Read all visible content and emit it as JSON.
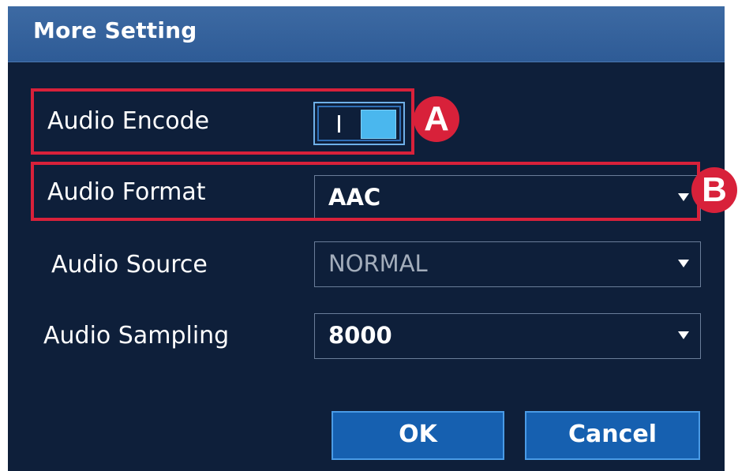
{
  "dialog": {
    "title": "More Setting"
  },
  "fields": {
    "audio_encode": {
      "label": "Audio Encode",
      "toggle_mark": "I",
      "enabled": true
    },
    "audio_format": {
      "label": "Audio Format",
      "value": "AAC"
    },
    "audio_source": {
      "label": "Audio Source",
      "value": "NORMAL",
      "disabled": true
    },
    "audio_sampling": {
      "label": "Audio Sampling",
      "value": "8000"
    }
  },
  "buttons": {
    "ok": "OK",
    "cancel": "Cancel"
  },
  "annotations": {
    "a": "A",
    "b": "B"
  },
  "colors": {
    "background": "#0e1f3a",
    "titlebar": "#2e5b96",
    "button": "#1660b0",
    "toggle_on": "#4ab7ee",
    "annotation": "#d8213a"
  }
}
